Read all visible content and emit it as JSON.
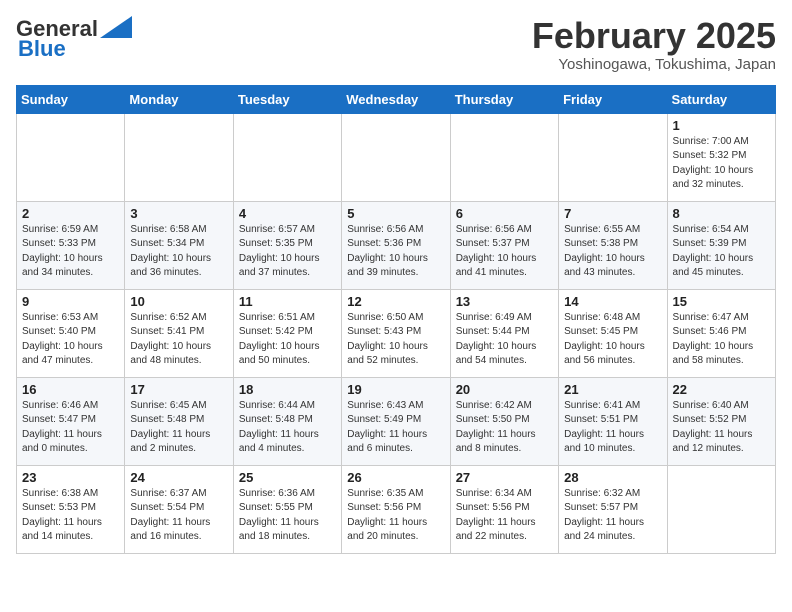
{
  "header": {
    "logo_general": "General",
    "logo_blue": "Blue",
    "month_title": "February 2025",
    "location": "Yoshinogawa, Tokushima, Japan"
  },
  "weekdays": [
    "Sunday",
    "Monday",
    "Tuesday",
    "Wednesday",
    "Thursday",
    "Friday",
    "Saturday"
  ],
  "weeks": [
    [
      {
        "day": "",
        "info": ""
      },
      {
        "day": "",
        "info": ""
      },
      {
        "day": "",
        "info": ""
      },
      {
        "day": "",
        "info": ""
      },
      {
        "day": "",
        "info": ""
      },
      {
        "day": "",
        "info": ""
      },
      {
        "day": "1",
        "info": "Sunrise: 7:00 AM\nSunset: 5:32 PM\nDaylight: 10 hours\nand 32 minutes."
      }
    ],
    [
      {
        "day": "2",
        "info": "Sunrise: 6:59 AM\nSunset: 5:33 PM\nDaylight: 10 hours\nand 34 minutes."
      },
      {
        "day": "3",
        "info": "Sunrise: 6:58 AM\nSunset: 5:34 PM\nDaylight: 10 hours\nand 36 minutes."
      },
      {
        "day": "4",
        "info": "Sunrise: 6:57 AM\nSunset: 5:35 PM\nDaylight: 10 hours\nand 37 minutes."
      },
      {
        "day": "5",
        "info": "Sunrise: 6:56 AM\nSunset: 5:36 PM\nDaylight: 10 hours\nand 39 minutes."
      },
      {
        "day": "6",
        "info": "Sunrise: 6:56 AM\nSunset: 5:37 PM\nDaylight: 10 hours\nand 41 minutes."
      },
      {
        "day": "7",
        "info": "Sunrise: 6:55 AM\nSunset: 5:38 PM\nDaylight: 10 hours\nand 43 minutes."
      },
      {
        "day": "8",
        "info": "Sunrise: 6:54 AM\nSunset: 5:39 PM\nDaylight: 10 hours\nand 45 minutes."
      }
    ],
    [
      {
        "day": "9",
        "info": "Sunrise: 6:53 AM\nSunset: 5:40 PM\nDaylight: 10 hours\nand 47 minutes."
      },
      {
        "day": "10",
        "info": "Sunrise: 6:52 AM\nSunset: 5:41 PM\nDaylight: 10 hours\nand 48 minutes."
      },
      {
        "day": "11",
        "info": "Sunrise: 6:51 AM\nSunset: 5:42 PM\nDaylight: 10 hours\nand 50 minutes."
      },
      {
        "day": "12",
        "info": "Sunrise: 6:50 AM\nSunset: 5:43 PM\nDaylight: 10 hours\nand 52 minutes."
      },
      {
        "day": "13",
        "info": "Sunrise: 6:49 AM\nSunset: 5:44 PM\nDaylight: 10 hours\nand 54 minutes."
      },
      {
        "day": "14",
        "info": "Sunrise: 6:48 AM\nSunset: 5:45 PM\nDaylight: 10 hours\nand 56 minutes."
      },
      {
        "day": "15",
        "info": "Sunrise: 6:47 AM\nSunset: 5:46 PM\nDaylight: 10 hours\nand 58 minutes."
      }
    ],
    [
      {
        "day": "16",
        "info": "Sunrise: 6:46 AM\nSunset: 5:47 PM\nDaylight: 11 hours\nand 0 minutes."
      },
      {
        "day": "17",
        "info": "Sunrise: 6:45 AM\nSunset: 5:48 PM\nDaylight: 11 hours\nand 2 minutes."
      },
      {
        "day": "18",
        "info": "Sunrise: 6:44 AM\nSunset: 5:48 PM\nDaylight: 11 hours\nand 4 minutes."
      },
      {
        "day": "19",
        "info": "Sunrise: 6:43 AM\nSunset: 5:49 PM\nDaylight: 11 hours\nand 6 minutes."
      },
      {
        "day": "20",
        "info": "Sunrise: 6:42 AM\nSunset: 5:50 PM\nDaylight: 11 hours\nand 8 minutes."
      },
      {
        "day": "21",
        "info": "Sunrise: 6:41 AM\nSunset: 5:51 PM\nDaylight: 11 hours\nand 10 minutes."
      },
      {
        "day": "22",
        "info": "Sunrise: 6:40 AM\nSunset: 5:52 PM\nDaylight: 11 hours\nand 12 minutes."
      }
    ],
    [
      {
        "day": "23",
        "info": "Sunrise: 6:38 AM\nSunset: 5:53 PM\nDaylight: 11 hours\nand 14 minutes."
      },
      {
        "day": "24",
        "info": "Sunrise: 6:37 AM\nSunset: 5:54 PM\nDaylight: 11 hours\nand 16 minutes."
      },
      {
        "day": "25",
        "info": "Sunrise: 6:36 AM\nSunset: 5:55 PM\nDaylight: 11 hours\nand 18 minutes."
      },
      {
        "day": "26",
        "info": "Sunrise: 6:35 AM\nSunset: 5:56 PM\nDaylight: 11 hours\nand 20 minutes."
      },
      {
        "day": "27",
        "info": "Sunrise: 6:34 AM\nSunset: 5:56 PM\nDaylight: 11 hours\nand 22 minutes."
      },
      {
        "day": "28",
        "info": "Sunrise: 6:32 AM\nSunset: 5:57 PM\nDaylight: 11 hours\nand 24 minutes."
      },
      {
        "day": "",
        "info": ""
      }
    ]
  ]
}
